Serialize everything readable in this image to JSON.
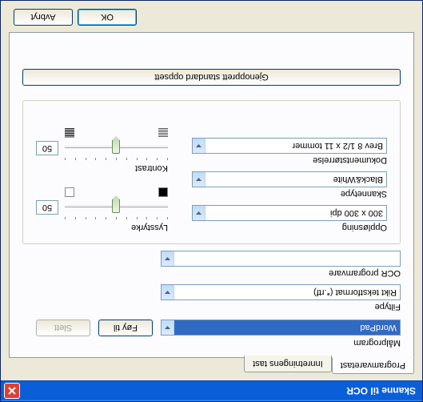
{
  "window": {
    "title": "Skanne til OCR"
  },
  "tabs": {
    "software": "Programvaretast",
    "device": "Innretningens tast"
  },
  "section1": {
    "target_label": "Målprogram",
    "target_value": "WordPad",
    "add_btn": "Føy til",
    "delete_btn": "Slett",
    "filetype_label": "Filtype",
    "filetype_value": "Rikt tekstformat (*.rtf)",
    "ocr_label": "OCR programvare",
    "ocr_value": ""
  },
  "group": {
    "resolution_label": "Oppløsning",
    "resolution_value": "300 x 300 dpi",
    "scantype_label": "Skannetype",
    "scantype_value": "Black&White",
    "docsize_label": "Dokumentstørrelse",
    "docsize_value": "Brev 8 1/2 x 11 tommer",
    "brightness_label": "Lysstyrke",
    "brightness_value": "50",
    "contrast_label": "Kontrast",
    "contrast_value": "50"
  },
  "buttons": {
    "restore": "Gjenopprett standard oppsett",
    "ok": "OK",
    "cancel": "Avbryt"
  }
}
